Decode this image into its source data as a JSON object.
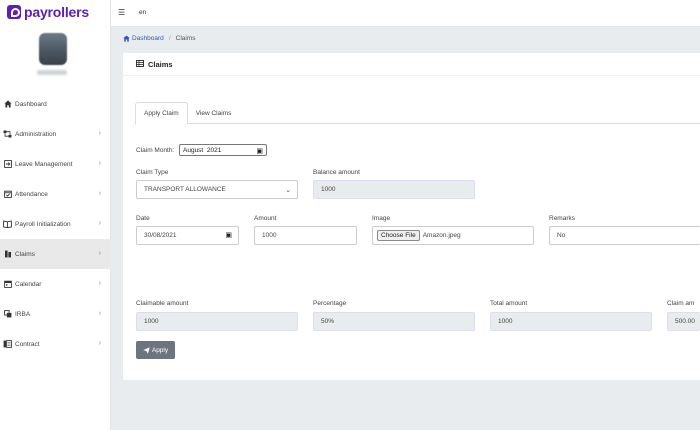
{
  "brand": {
    "name": "payrollers",
    "color": "#5b21b6"
  },
  "topbar": {
    "menu_icon": "hamburger-icon",
    "language": "en"
  },
  "sidebar": {
    "items": [
      {
        "label": "Dashboard",
        "icon": "home-icon",
        "chevron": false,
        "active": false
      },
      {
        "label": "Administration",
        "icon": "sitemap-icon",
        "chevron": true,
        "active": false
      },
      {
        "label": "Leave Management",
        "icon": "sign-out-icon",
        "chevron": true,
        "active": false
      },
      {
        "label": "Attendance",
        "icon": "calendar-check-icon",
        "chevron": true,
        "active": false
      },
      {
        "label": "Payroll Initialization",
        "icon": "book-icon",
        "chevron": true,
        "active": false
      },
      {
        "label": "Claims",
        "icon": "file-icon",
        "chevron": true,
        "active": true
      },
      {
        "label": "Calendar",
        "icon": "calendar-icon",
        "chevron": true,
        "active": false
      },
      {
        "label": "IRBA",
        "icon": "layers-icon",
        "chevron": true,
        "active": false
      },
      {
        "label": "Contract",
        "icon": "contract-icon",
        "chevron": true,
        "active": false
      }
    ]
  },
  "breadcrumb": {
    "home": "Dashboard",
    "current": "Claims"
  },
  "card": {
    "title": "Claims"
  },
  "tabs": [
    {
      "label": "Apply Claim"
    },
    {
      "label": "View Claims"
    }
  ],
  "form": {
    "claim_month": {
      "label": "Claim Month:",
      "value": "August  2021"
    },
    "claim_type": {
      "label": "Claim Type",
      "value": "TRANSPORT ALLOWANCE"
    },
    "balance_amount": {
      "label": "Balance amount",
      "value": "1000"
    },
    "date": {
      "label": "Date",
      "value": "30/08/2021"
    },
    "amount": {
      "label": "Amount",
      "value": "1000"
    },
    "image": {
      "label": "Image",
      "button": "Choose File",
      "file": "Amazon.jpeg"
    },
    "remarks": {
      "label": "Remarks",
      "value": "No"
    },
    "claimable_amount": {
      "label": "Claimable amount",
      "value": "1000"
    },
    "percentage": {
      "label": "Percentage",
      "value": "50%"
    },
    "total_amount": {
      "label": "Total amount",
      "value": "1000"
    },
    "claim_am": {
      "label": "Claim am",
      "value": "500.00"
    }
  },
  "apply_button": {
    "label": "Apply"
  },
  "colors": {
    "link": "#2f5bb7",
    "button": "#6c757d",
    "readonly_bg": "#e9ecef"
  }
}
